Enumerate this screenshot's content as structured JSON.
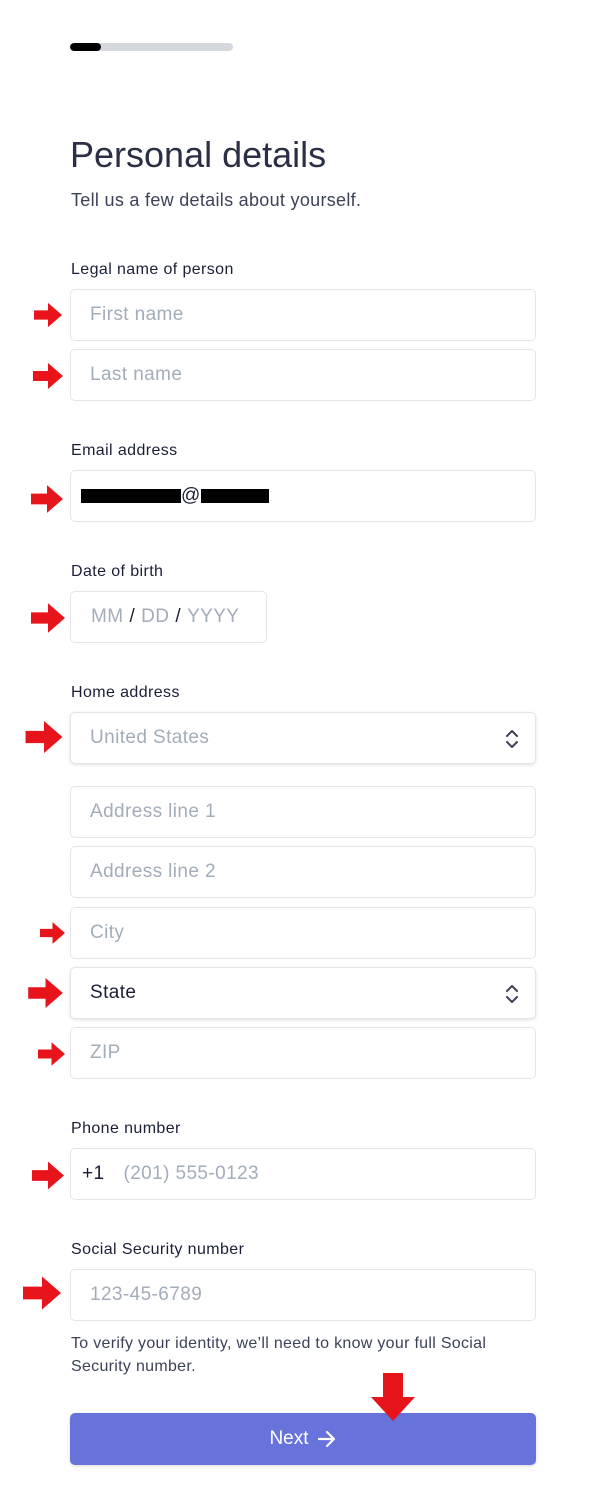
{
  "progress": {
    "fraction": 0.19
  },
  "header": {
    "title": "Personal details",
    "subtitle": "Tell us a few details about yourself."
  },
  "name": {
    "label": "Legal name of person",
    "first_placeholder": "First name",
    "last_placeholder": "Last name"
  },
  "email": {
    "label": "Email address",
    "value_visible": "@"
  },
  "dob": {
    "label": "Date of birth",
    "mm": "MM",
    "dd": "DD",
    "yyyy": "YYYY",
    "sep": "/"
  },
  "address": {
    "label": "Home address",
    "country": "United States",
    "line1_placeholder": "Address line 1",
    "line2_placeholder": "Address line 2",
    "city_placeholder": "City",
    "state": "State",
    "zip_placeholder": "ZIP"
  },
  "phone": {
    "label": "Phone number",
    "prefix": "+1",
    "placeholder": "(201) 555-0123"
  },
  "ssn": {
    "label": "Social Security number",
    "placeholder": "123-45-6789",
    "help": "To verify your identity, we’ll need to know your full Social Security number."
  },
  "next": {
    "label": "Next",
    "icon": "arrow-right-icon"
  },
  "colors": {
    "accent": "#6772db",
    "annotation": "#e8141c"
  }
}
